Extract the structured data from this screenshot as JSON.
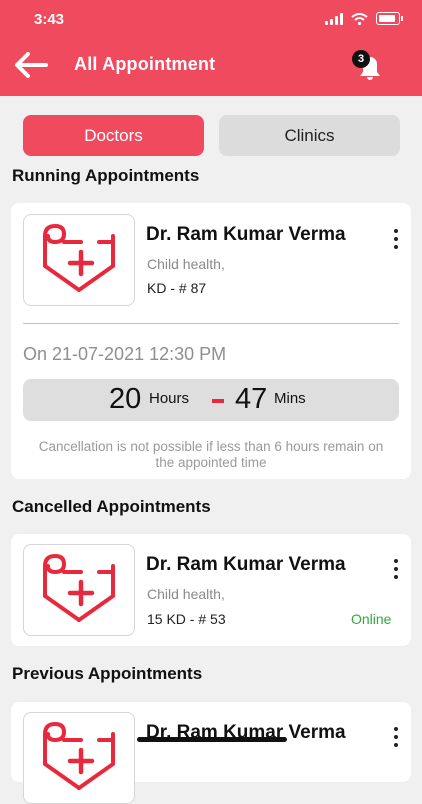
{
  "status_bar": {
    "time": "3:43"
  },
  "header": {
    "title": "All Appointment",
    "notification_count": "3"
  },
  "tabs": [
    {
      "label": "Doctors",
      "active": true
    },
    {
      "label": "Clinics",
      "active": false
    }
  ],
  "sections": {
    "running": "Running Appointments",
    "cancelled": "Cancelled Appointments",
    "previous": "Previous Appointments"
  },
  "running_card": {
    "doctor": "Dr. Ram Kumar Verma",
    "specialty": "Child health,",
    "code": "KD - # 87",
    "date": "On 21-07-2021 12:30 PM",
    "hours_value": "20",
    "hours_unit": "Hours",
    "mins_value": "47",
    "mins_unit": "Mins",
    "note": "Cancellation is not possible if less than 6 hours remain on the appointed time"
  },
  "cancelled_card": {
    "doctor": "Dr. Ram Kumar Verma",
    "specialty": "Child health,",
    "code": "15 KD - # 53",
    "mode": "Online"
  },
  "previous_card": {
    "doctor": "Dr. Ram Kumar Verma"
  },
  "colors": {
    "brand": "#f04a5e",
    "online": "#2eaa3e",
    "dash": "#e8283d"
  }
}
